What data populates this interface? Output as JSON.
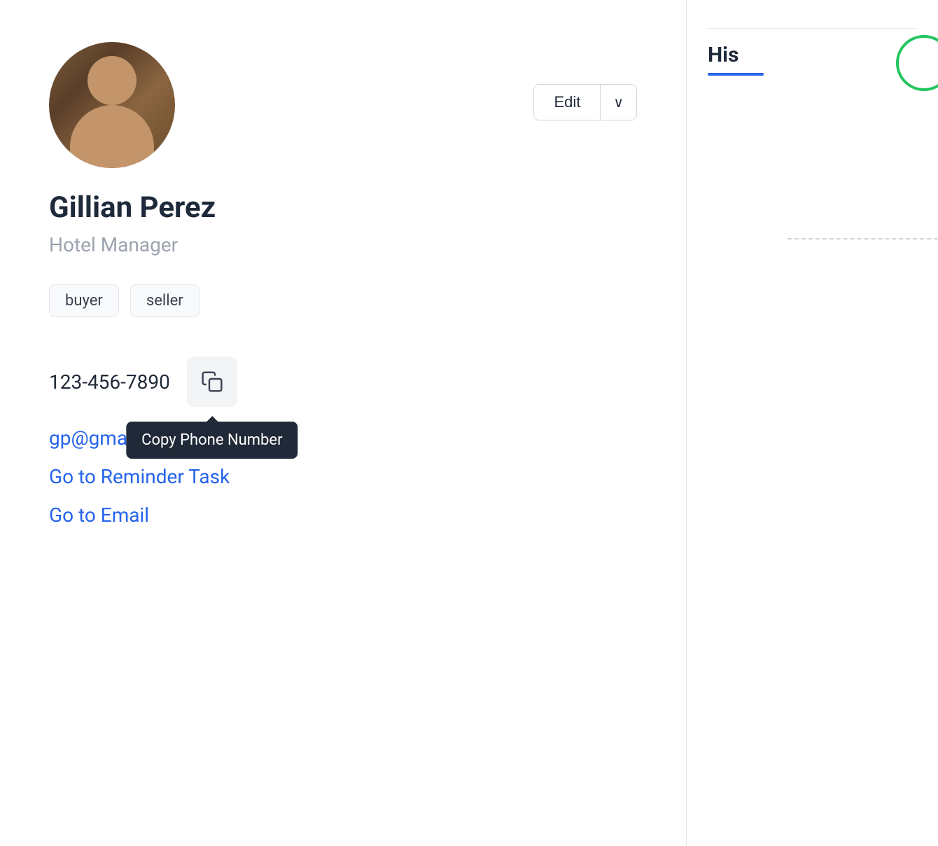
{
  "contact": {
    "name": "Gillian Perez",
    "role": "Hotel Manager",
    "phone": "123-456-7890",
    "email": "gp@gmail.com",
    "tags": [
      "buyer",
      "seller"
    ],
    "action_links": [
      "Go to Reminder Task",
      "Go to Email"
    ]
  },
  "header": {
    "edit_label": "Edit",
    "chevron": "∨"
  },
  "right_panel": {
    "title": "His"
  },
  "tooltip": {
    "label": "Copy Phone Number"
  },
  "buttons": {
    "copy_icon": "⧉"
  }
}
